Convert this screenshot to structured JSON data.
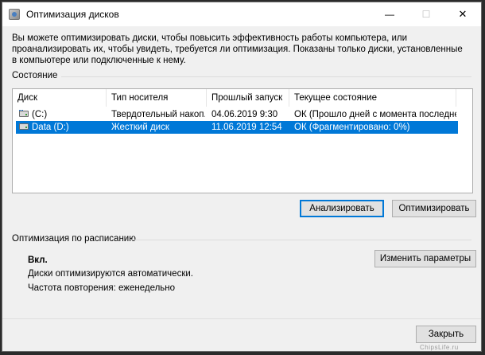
{
  "window": {
    "title": "Оптимизация дисков",
    "controls": {
      "minimize": "—",
      "maximize": "☐",
      "close": "✕"
    }
  },
  "description": "Вы можете оптимизировать диски, чтобы повысить эффективность работы компьютера, или проанализировать их, чтобы увидеть, требуется ли оптимизация. Показаны только диски, установленные в компьютере или подключенные к нему.",
  "status_section": {
    "label": "Состояние",
    "columns": [
      "Диск",
      "Тип носителя",
      "Прошлый запуск",
      "Текущее состояние"
    ],
    "rows": [
      {
        "drive": "(C:)",
        "icon": "system-drive-icon",
        "media_type": "Твердотельный накоп...",
        "last_run": "04.06.2019 9:30",
        "status": "ОК (Прошло дней с момента последне...",
        "selected": false
      },
      {
        "drive": "Data (D:)",
        "icon": "hard-drive-icon",
        "media_type": "Жесткий диск",
        "last_run": "11.06.2019 12:54",
        "status": "ОК (Фрагментировано: 0%)",
        "selected": true
      }
    ],
    "analyze_button": "Анализировать",
    "optimize_button": "Оптимизировать"
  },
  "schedule_section": {
    "label": "Оптимизация по расписанию",
    "state": "Вкл.",
    "auto_text": "Диски оптимизируются автоматически.",
    "frequency_text": "Частота повторения: еженедельно",
    "change_button": "Изменить параметры"
  },
  "footer": {
    "close_button": "Закрыть"
  },
  "watermark": "ChipsLife.ru",
  "colors": {
    "selection": "#0078d7",
    "window_bg": "#f0f0f0",
    "button_bg": "#e1e1e1"
  }
}
